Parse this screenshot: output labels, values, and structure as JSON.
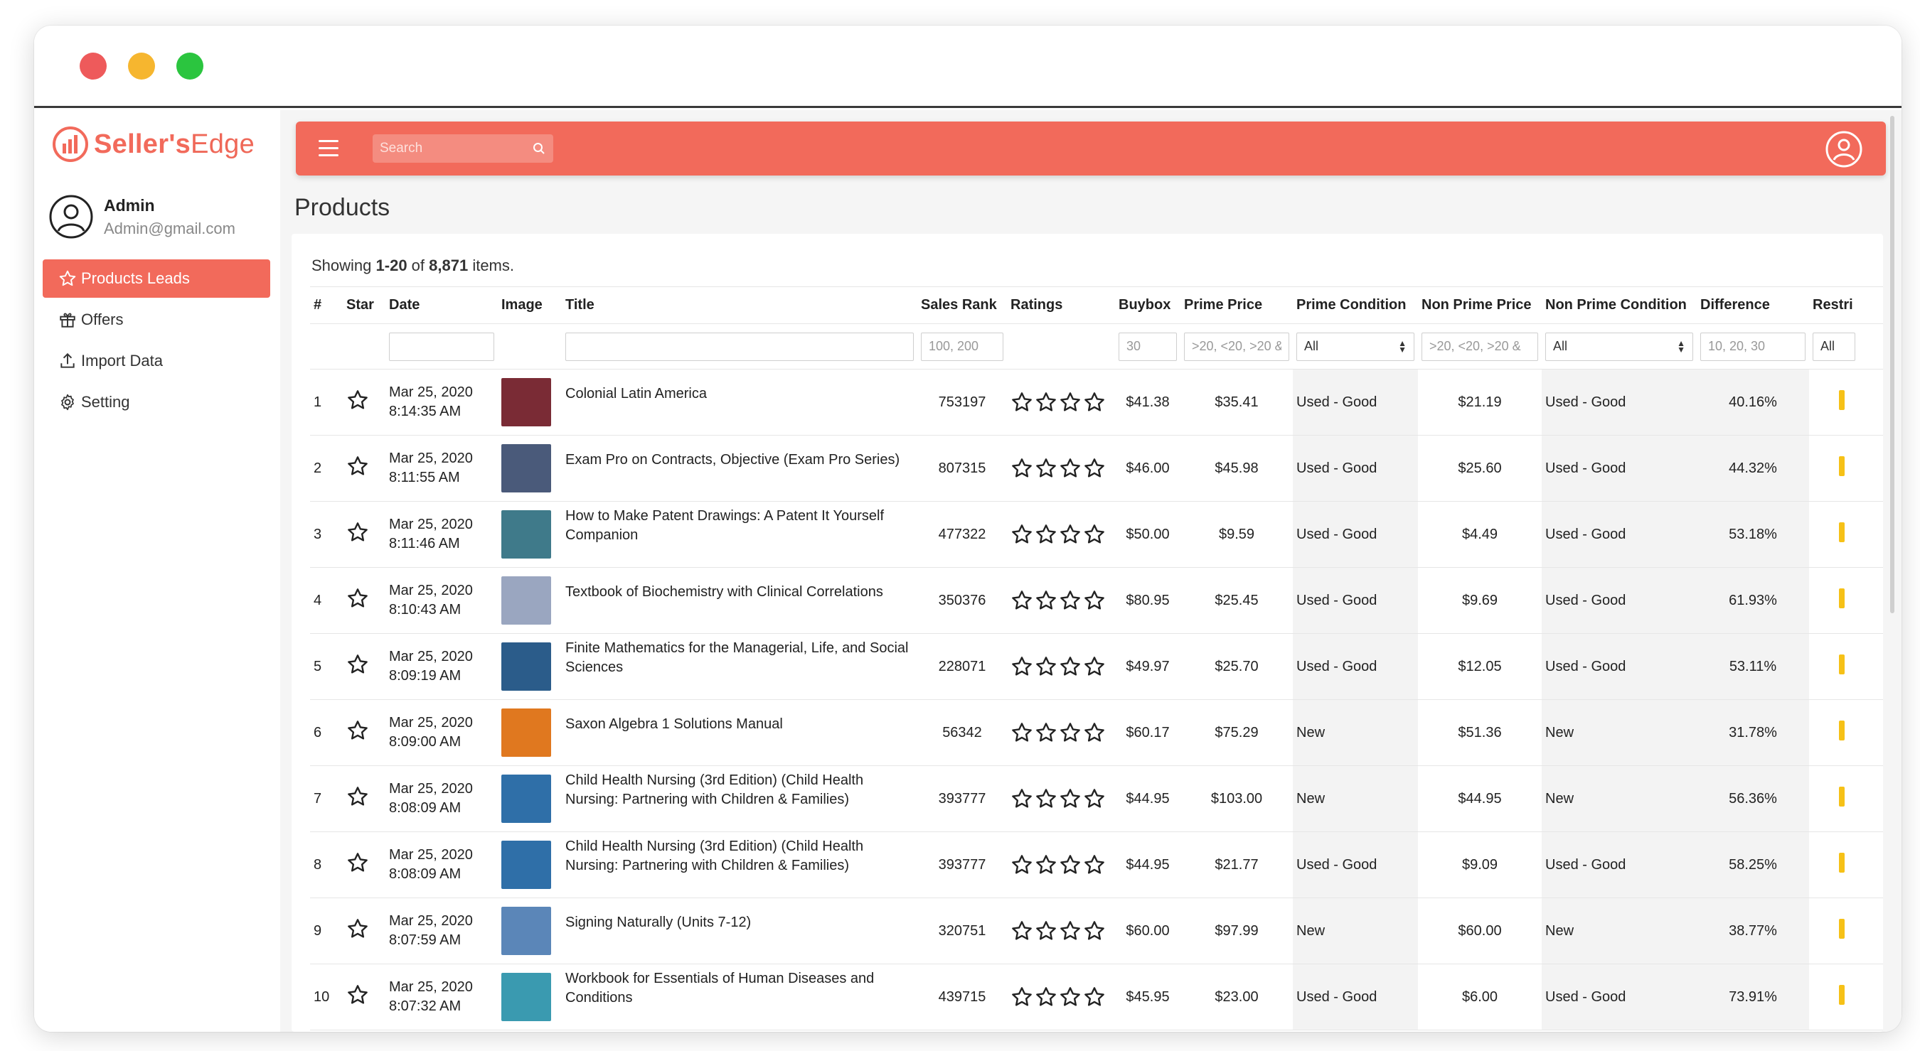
{
  "window": {
    "controls": [
      "close",
      "minimize",
      "maximize"
    ]
  },
  "sidebar": {
    "logo": {
      "brand": "Seller's",
      "edge": "Edge"
    },
    "profile": {
      "name": "Admin",
      "email": "Admin@gmail.com"
    },
    "items": [
      {
        "label": "Products Leads",
        "icon": "star-icon",
        "active": true
      },
      {
        "label": "Offers",
        "icon": "gift-icon",
        "active": false
      },
      {
        "label": "Import Data",
        "icon": "upload-icon",
        "active": false
      },
      {
        "label": "Setting",
        "icon": "gear-icon",
        "active": false
      }
    ]
  },
  "topbar": {
    "search_placeholder": "Search"
  },
  "page": {
    "title": "Products",
    "showing_prefix": "Showing ",
    "showing_range": "1-20",
    "showing_of": " of ",
    "showing_total": "8,871",
    "showing_suffix": " items."
  },
  "table": {
    "columns": [
      "#",
      "Star",
      "Date",
      "Image",
      "Title",
      "Sales Rank",
      "Ratings",
      "Buybox",
      "Prime Price",
      "Prime Condition",
      "Non Prime Price",
      "Non Prime Condition",
      "Difference",
      "Restri"
    ],
    "filters": {
      "sales_rank_placeholder": "100, 200",
      "buybox_placeholder": "30",
      "prime_price_placeholder": ">20, <20, >20 &",
      "prime_condition_value": "All",
      "non_prime_price_placeholder": ">20, <20, >20 &",
      "non_prime_condition_value": "All",
      "difference_placeholder": "10, 20, 30",
      "restri_value": "All"
    },
    "rows": [
      {
        "num": "1",
        "date": "Mar 25, 2020",
        "time": "8:14:35 AM",
        "title": "Colonial Latin America",
        "sales_rank": "753197",
        "buybox": "$41.38",
        "prime_price": "$35.41",
        "prime_condition": "Used - Good",
        "non_prime_price": "$21.19",
        "non_prime_condition": "Used - Good",
        "difference": "40.16%",
        "thumb_color": "#7a2b35"
      },
      {
        "num": "2",
        "date": "Mar 25, 2020",
        "time": "8:11:55 AM",
        "title": "Exam Pro on Contracts, Objective (Exam Pro Series)",
        "sales_rank": "807315",
        "buybox": "$46.00",
        "prime_price": "$45.98",
        "prime_condition": "Used - Good",
        "non_prime_price": "$25.60",
        "non_prime_condition": "Used - Good",
        "difference": "44.32%",
        "thumb_color": "#4a5a7a"
      },
      {
        "num": "3",
        "date": "Mar 25, 2020",
        "time": "8:11:46 AM",
        "title": "How to Make Patent Drawings: A Patent It Yourself Companion",
        "sales_rank": "477322",
        "buybox": "$50.00",
        "prime_price": "$9.59",
        "prime_condition": "Used - Good",
        "non_prime_price": "$4.49",
        "non_prime_condition": "Used - Good",
        "difference": "53.18%",
        "thumb_color": "#3f7a8a"
      },
      {
        "num": "4",
        "date": "Mar 25, 2020",
        "time": "8:10:43 AM",
        "title": "Textbook of Biochemistry with Clinical Correlations",
        "sales_rank": "350376",
        "buybox": "$80.95",
        "prime_price": "$25.45",
        "prime_condition": "Used - Good",
        "non_prime_price": "$9.69",
        "non_prime_condition": "Used - Good",
        "difference": "61.93%",
        "thumb_color": "#9aa6c0"
      },
      {
        "num": "5",
        "date": "Mar 25, 2020",
        "time": "8:09:19 AM",
        "title": "Finite Mathematics for the Managerial, Life, and Social Sciences",
        "sales_rank": "228071",
        "buybox": "$49.97",
        "prime_price": "$25.70",
        "prime_condition": "Used - Good",
        "non_prime_price": "$12.05",
        "non_prime_condition": "Used - Good",
        "difference": "53.11%",
        "thumb_color": "#2b5c8a"
      },
      {
        "num": "6",
        "date": "Mar 25, 2020",
        "time": "8:09:00 AM",
        "title": "Saxon Algebra 1 Solutions Manual",
        "sales_rank": "56342",
        "buybox": "$60.17",
        "prime_price": "$75.29",
        "prime_condition": "New",
        "non_prime_price": "$51.36",
        "non_prime_condition": "New",
        "difference": "31.78%",
        "thumb_color": "#e0781f"
      },
      {
        "num": "7",
        "date": "Mar 25, 2020",
        "time": "8:08:09 AM",
        "title": "Child Health Nursing (3rd Edition) (Child Health Nursing: Partnering with Children & Families)",
        "sales_rank": "393777",
        "buybox": "$44.95",
        "prime_price": "$103.00",
        "prime_condition": "New",
        "non_prime_price": "$44.95",
        "non_prime_condition": "New",
        "difference": "56.36%",
        "thumb_color": "#2f6fa8"
      },
      {
        "num": "8",
        "date": "Mar 25, 2020",
        "time": "8:08:09 AM",
        "title": "Child Health Nursing (3rd Edition) (Child Health Nursing: Partnering with Children & Families)",
        "sales_rank": "393777",
        "buybox": "$44.95",
        "prime_price": "$21.77",
        "prime_condition": "Used - Good",
        "non_prime_price": "$9.09",
        "non_prime_condition": "Used - Good",
        "difference": "58.25%",
        "thumb_color": "#2f6fa8"
      },
      {
        "num": "9",
        "date": "Mar 25, 2020",
        "time": "8:07:59 AM",
        "title": "Signing Naturally (Units 7-12)",
        "sales_rank": "320751",
        "buybox": "$60.00",
        "prime_price": "$97.99",
        "prime_condition": "New",
        "non_prime_price": "$60.00",
        "non_prime_condition": "New",
        "difference": "38.77%",
        "thumb_color": "#5b86b8"
      },
      {
        "num": "10",
        "date": "Mar 25, 2020",
        "time": "8:07:32 AM",
        "title": "Workbook for Essentials of Human Diseases and Conditions",
        "sales_rank": "439715",
        "buybox": "$45.95",
        "prime_price": "$23.00",
        "prime_condition": "Used - Good",
        "non_prime_price": "$6.00",
        "non_prime_condition": "Used - Good",
        "difference": "73.91%",
        "thumb_color": "#3a9ab0"
      }
    ]
  },
  "colors": {
    "accent": "#f26a5b",
    "restriction": "#f6c117"
  }
}
